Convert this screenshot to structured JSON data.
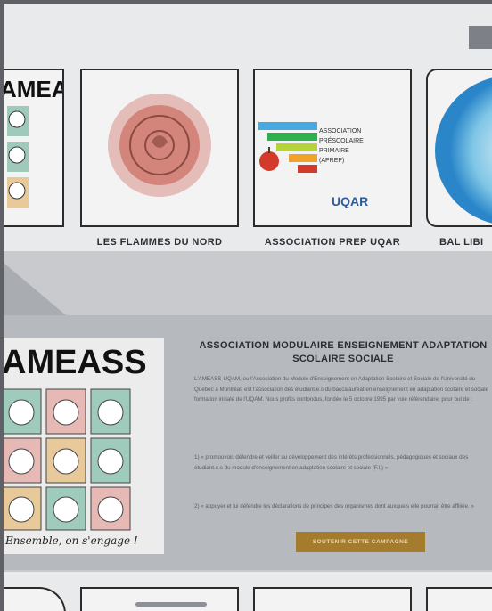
{
  "close": {
    "icon": "close-icon"
  },
  "cards": [
    {
      "label": "",
      "image": "ameass-comic-image"
    },
    {
      "label": "LES FLAMMES DU NORD",
      "image": "flammes-seal-logo"
    },
    {
      "label": "ASSOCIATION PREP UQAR",
      "image": "prep-uqar-logo",
      "logo_lines": [
        "ASSOCIATION",
        "PRÉSCOLAIRE",
        "PRIMAIRE",
        "(APREP)"
      ],
      "logo_brand": "UQAR"
    },
    {
      "label": "BAL LIBI",
      "image": "bal-libre-logo"
    }
  ],
  "ameass_logo_text": "AMEASS",
  "ameass_caption": "Ensemble, on s'engage !",
  "feature": {
    "title": "ASSOCIATION MODULAIRE ENSEIGNEMENT ADAPTATION SCOLAIRE SOCIALE",
    "paragraphs": [
      "L'AMEASS-UQAM, ou l'Association du Module d'Enseignement en Adaptation Scolaire et Sociale de l'Université du Québec à Montréal, est l'association des étudiant.e.s du baccalauréat en enseignement en adaptation scolaire et sociale formation initiale de l'UQAM. Nous profits confondus, fondée le 5 octobre 1995 par voie référendaire, pour but de :",
      "1) « promouvoir, défendre et veiller au développement des intérêts professionnels, pédagogiques et sociaux des étudiant.e.s du module d'enseignement en adaptation scolaire et sociale (F.I.) »",
      "2) « appuyer et lui défendre les déclarations de principes des organismes dont auxquels elle pourrait être affiliée. »"
    ],
    "cta_label": "SOUTENIR CETTE CAMPAGNE"
  },
  "colors": {
    "overlay": "#5f6166",
    "page": "#e9eaec",
    "band": "#b6b9be",
    "cta": "#a57c2e",
    "prep_bars": [
      "#4aa8e0",
      "#2fb04f",
      "#b7d33a",
      "#f0a22b",
      "#d33a2c"
    ]
  }
}
